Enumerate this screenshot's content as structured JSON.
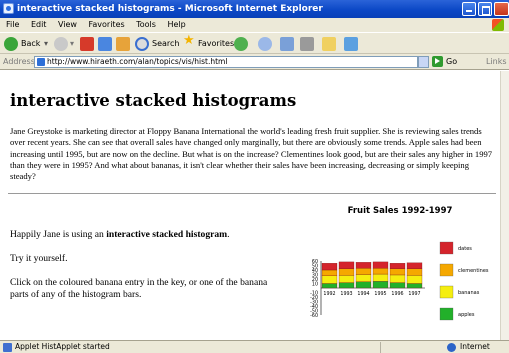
{
  "window": {
    "title": "interactive stacked histograms - Microsoft Internet Explorer"
  },
  "menu": [
    "File",
    "Edit",
    "View",
    "Favorites",
    "Tools",
    "Help"
  ],
  "toolbar": {
    "back_label": "Back",
    "search_label": "Search",
    "favorites_label": "Favorites"
  },
  "address": {
    "label": "Address",
    "url": "http://www.hiraeth.com/alan/topics/vis/hist.html",
    "go_label": "Go",
    "links_label": "Links"
  },
  "page": {
    "title": "interactive stacked histograms",
    "intro": "Jane Greystoke is marketing director at Floppy Banana International the world's leading fresh fruit supplier. She is reviewing sales trends over recent years. She can see that overall sales have changed only marginally, but there are obviously some trends. Apple sales had been increasing until 1995, but are now on the decline. But what is on the increase? Clementines look good, but are their sales any higher in 1997 than they were in 1995? And what about bananas, it isn't clear whether their sales have been increasing, decreasing or simply keeping steady?",
    "p1_prefix": "Happily Jane is using an ",
    "p1_bold": "interactive stacked histogram",
    "p1_suffix": ".",
    "p2": "Try it yourself.",
    "p3": "Click on the coloured banana entry in the key, or one of the banana parts of any of the histogram bars."
  },
  "chart_data": {
    "type": "bar",
    "stacked": true,
    "title": "Fruit Sales 1992-1997",
    "categories": [
      "1992",
      "1993",
      "1994",
      "1995",
      "1996",
      "1997"
    ],
    "ylim": [
      -60,
      60
    ],
    "yticks": [
      60,
      50,
      40,
      30,
      20,
      10,
      -10,
      -20,
      -30,
      -40,
      -50,
      -60
    ],
    "series": [
      {
        "name": "apples",
        "color": "#22b02a",
        "values": [
          10,
          12,
          14,
          15,
          12,
          10
        ]
      },
      {
        "name": "bananas",
        "color": "#f5ee10",
        "values": [
          17,
          16,
          16,
          16,
          17,
          18
        ]
      },
      {
        "name": "clementines",
        "color": "#f5a800",
        "values": [
          13,
          15,
          14,
          13,
          14,
          15
        ]
      },
      {
        "name": "dates",
        "color": "#d4242c",
        "values": [
          15,
          15,
          13,
          14,
          12,
          13
        ]
      }
    ],
    "legend": "right"
  },
  "status": {
    "text": "Applet HistApplet started",
    "zone": "Internet"
  }
}
